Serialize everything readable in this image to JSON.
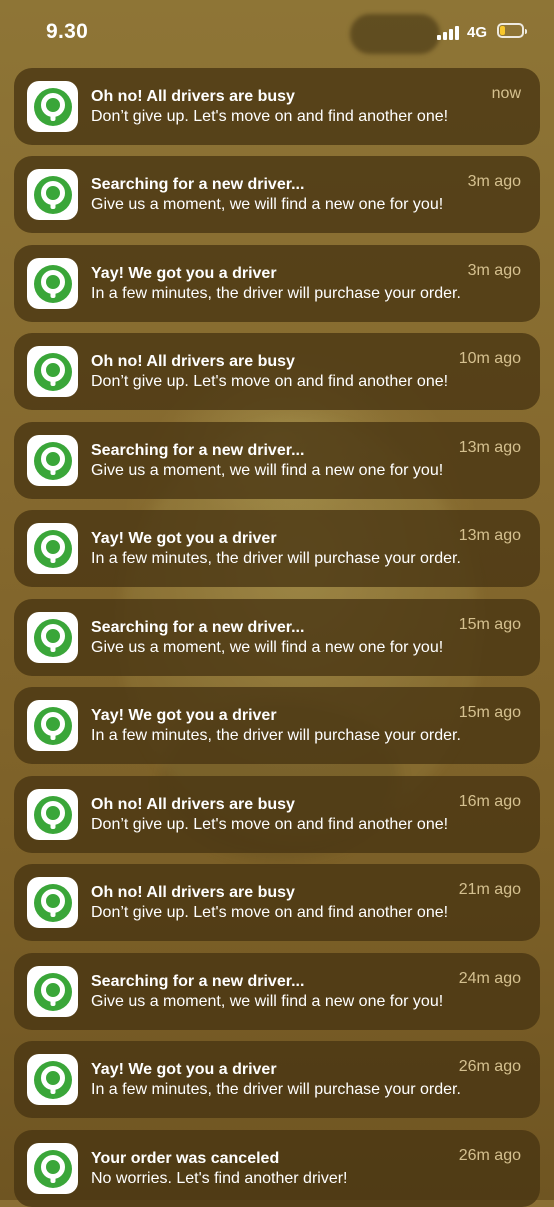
{
  "status_bar": {
    "time": "9.30",
    "network": "4G",
    "battery_level": 0.25,
    "battery_color": "#f7c72c"
  },
  "app_icon": "gojek-logo-icon",
  "brand_color": "#3aa639",
  "notifications": [
    {
      "title": "Oh no! All drivers are busy",
      "body": "Don’t give up. Let's move on and find another one!",
      "time": "now"
    },
    {
      "title": "Searching for a new driver...",
      "body": "Give us a moment, we will find a new one for you!",
      "time": "3m ago"
    },
    {
      "title": "Yay! We got you a driver",
      "body": "In a few minutes, the driver will purchase your order.",
      "time": "3m ago"
    },
    {
      "title": "Oh no! All drivers are busy",
      "body": "Don’t give up. Let's move on and find another one!",
      "time": "10m ago"
    },
    {
      "title": "Searching for a new driver...",
      "body": "Give us a moment, we will find a new one for you!",
      "time": "13m ago"
    },
    {
      "title": "Yay! We got you a driver",
      "body": "In a few minutes, the driver will purchase your order.",
      "time": "13m ago"
    },
    {
      "title": "Searching for a new driver...",
      "body": "Give us a moment, we will find a new one for you!",
      "time": "15m ago"
    },
    {
      "title": "Yay! We got you a driver",
      "body": "In a few minutes, the driver will purchase your order.",
      "time": "15m ago"
    },
    {
      "title": "Oh no! All drivers are busy",
      "body": "Don’t give up. Let's move on and find another one!",
      "time": "16m ago"
    },
    {
      "title": "Oh no! All drivers are busy",
      "body": "Don’t give up. Let's move on and find another one!",
      "time": "21m ago"
    },
    {
      "title": "Searching for a new driver...",
      "body": "Give us a moment, we will find a new one for you!",
      "time": "24m ago"
    },
    {
      "title": "Yay! We got you a driver",
      "body": "In a few minutes, the driver will purchase your order.",
      "time": "26m ago"
    },
    {
      "title": "Your order was canceled",
      "body": "No worries. Let's find another driver!",
      "time": "26m ago"
    }
  ]
}
